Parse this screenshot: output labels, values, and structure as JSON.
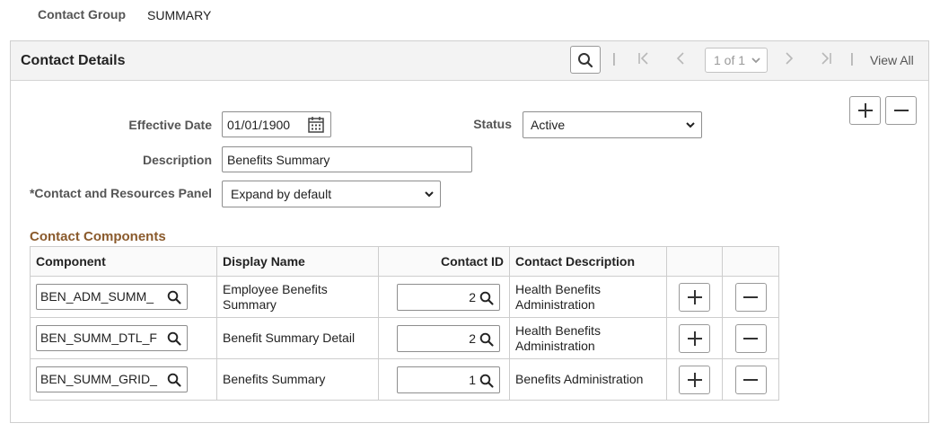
{
  "contact_group": {
    "label": "Contact Group",
    "value": "SUMMARY"
  },
  "panel": {
    "title": "Contact Details",
    "nav": {
      "row_counter": "1 of 1",
      "view_all": "View All",
      "separator": "|"
    }
  },
  "fields": {
    "effective_date": {
      "label": "Effective Date",
      "value": "01/01/1900"
    },
    "status": {
      "label": "Status",
      "value": "Active"
    },
    "description": {
      "label": "Description",
      "value": "Benefits Summary"
    },
    "contact_panel": {
      "label": "*Contact and Resources Panel",
      "value": "Expand by default"
    }
  },
  "components": {
    "title": "Contact Components",
    "columns": [
      "Component",
      "Display Name",
      "Contact ID",
      "Contact Description"
    ],
    "rows": [
      {
        "component": "BEN_ADM_SUMM_",
        "display_name": "Employee Benefits Summary",
        "contact_id": "2",
        "contact_description": "Health Benefits Administration"
      },
      {
        "component": "BEN_SUMM_DTL_F",
        "display_name": "Benefit Summary Detail",
        "contact_id": "2",
        "contact_description": "Health Benefits Administration"
      },
      {
        "component": "BEN_SUMM_GRID_",
        "display_name": "Benefits Summary",
        "contact_id": "1",
        "contact_description": "Benefits Administration"
      }
    ]
  },
  "icons": {
    "search": "search-icon",
    "first": "first-page-icon",
    "prev": "previous-icon",
    "next": "next-icon",
    "last": "last-page-icon",
    "calendar": "calendar-icon",
    "add": "plus-icon",
    "delete": "minus-icon"
  },
  "colors": {
    "section_title": "#8a5a2c",
    "header_bg": "#f3f3f3"
  }
}
